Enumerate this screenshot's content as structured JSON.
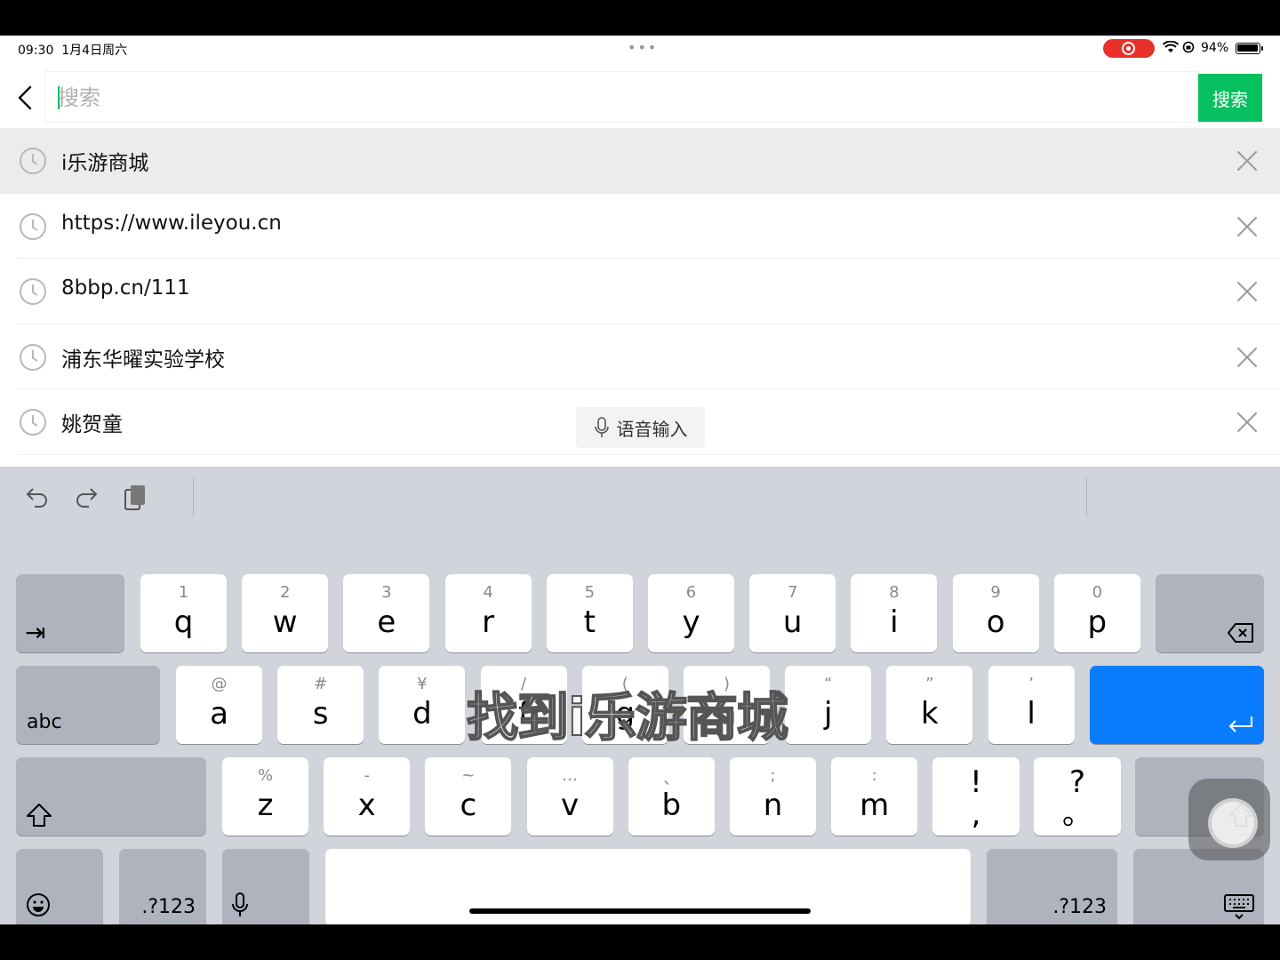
{
  "status_bar": {
    "time": "09:30",
    "date": "1月4日周六",
    "dots": "•••",
    "battery_pct": "94%",
    "battery_level": 0.94
  },
  "search": {
    "placeholder": "搜索",
    "button_label": "搜索"
  },
  "history": [
    {
      "text": "i乐游商城"
    },
    {
      "text": "https://www.ileyou.cn"
    },
    {
      "text": "8bbp.cn/111"
    },
    {
      "text": "浦东华曜实验学校"
    },
    {
      "text": "姚贺童"
    }
  ],
  "voice_input": {
    "label": "语音输入"
  },
  "keyboard": {
    "row1": [
      {
        "hint": "1",
        "key": "q"
      },
      {
        "hint": "2",
        "key": "w"
      },
      {
        "hint": "3",
        "key": "e"
      },
      {
        "hint": "4",
        "key": "r"
      },
      {
        "hint": "5",
        "key": "t"
      },
      {
        "hint": "6",
        "key": "y"
      },
      {
        "hint": "7",
        "key": "u"
      },
      {
        "hint": "8",
        "key": "i"
      },
      {
        "hint": "9",
        "key": "o"
      },
      {
        "hint": "0",
        "key": "p"
      }
    ],
    "row2": [
      {
        "hint": "@",
        "key": "a"
      },
      {
        "hint": "#",
        "key": "s"
      },
      {
        "hint": "¥",
        "key": "d"
      },
      {
        "hint": "/",
        "key": "f"
      },
      {
        "hint": "(",
        "key": "g"
      },
      {
        "hint": ")",
        "key": "h"
      },
      {
        "hint": "“",
        "key": "j"
      },
      {
        "hint": "”",
        "key": "k"
      },
      {
        "hint": "’",
        "key": "l"
      }
    ],
    "row3": [
      {
        "hint": "%",
        "key": "z"
      },
      {
        "hint": "-",
        "key": "x"
      },
      {
        "hint": "~",
        "key": "c"
      },
      {
        "hint": "…",
        "key": "v"
      },
      {
        "hint": "、",
        "key": "b"
      },
      {
        "hint": ";",
        "key": "n"
      },
      {
        "hint": ":",
        "key": "m"
      }
    ],
    "punct1": {
      "top": "!",
      "bottom": ","
    },
    "punct2": {
      "top": "?",
      "bottom": "。"
    },
    "abc_label": "abc",
    "num_label": ".?123"
  },
  "overlay_caption": "找到i乐游商城"
}
